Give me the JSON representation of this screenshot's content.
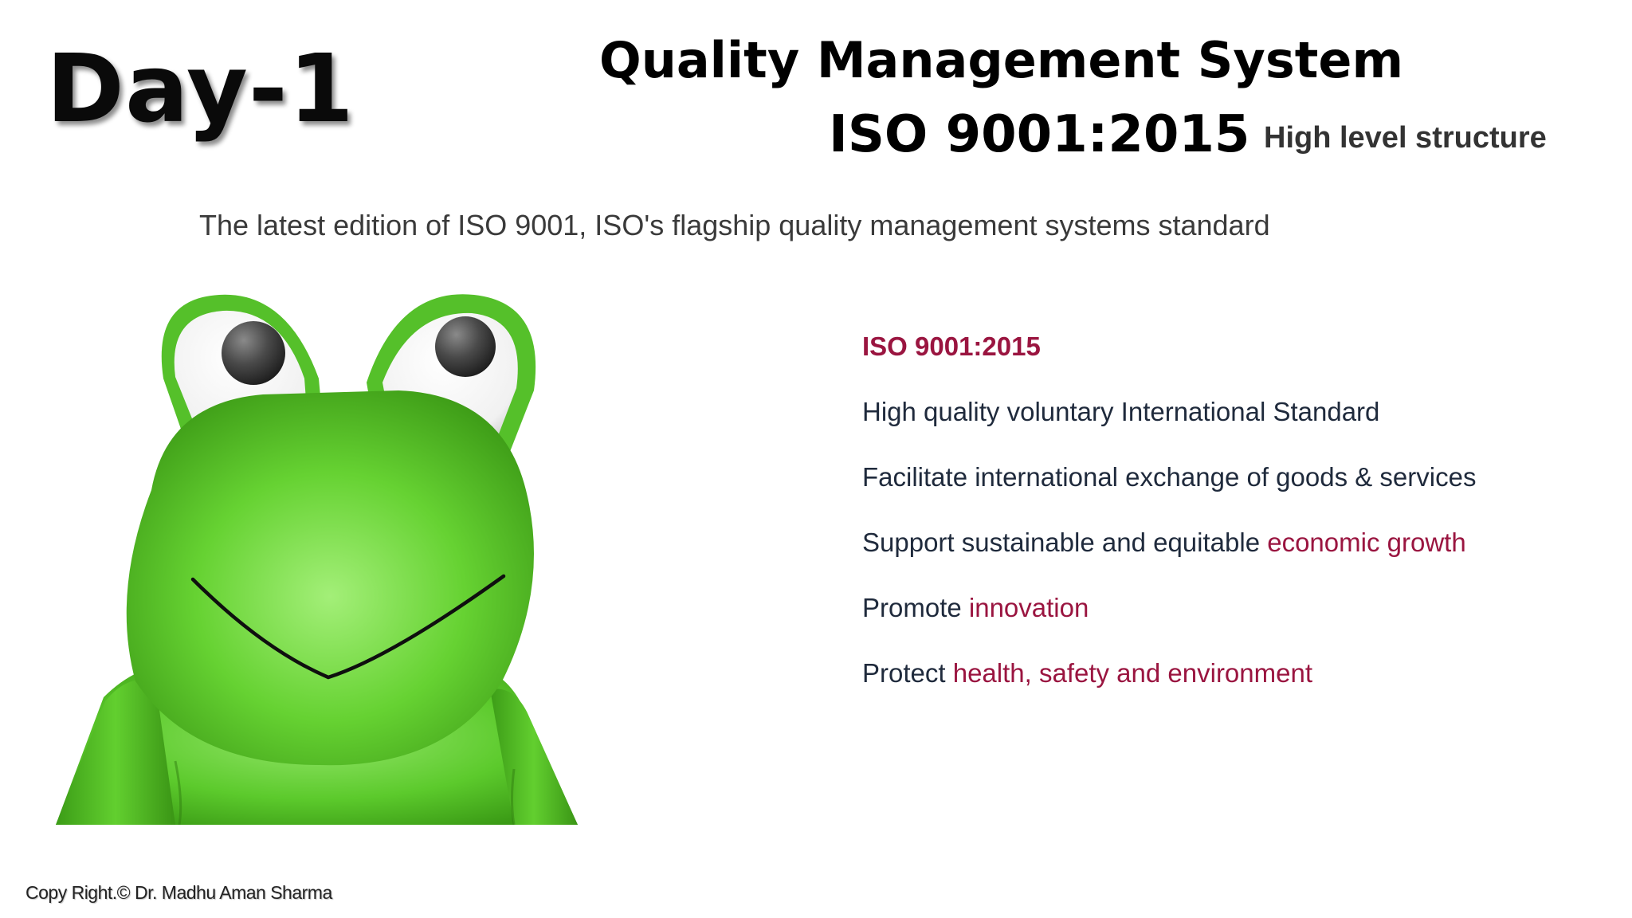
{
  "slide": {
    "day_label": "Day-1",
    "title_line1": "Quality Management System",
    "title_line2": "ISO 9001:2015",
    "subtitle_right": "High level structure",
    "intro": "The latest edition of ISO 9001, ISO's flagship quality management systems standard",
    "mascot_icon": "frog-mascot-icon",
    "bullets": {
      "heading": "ISO 9001:2015",
      "item1": "High quality voluntary International Standard",
      "item2": "Facilitate international exchange of goods & services",
      "item3_prefix": "Support sustainable and equitable ",
      "item3_accent": "economic growth",
      "item4_prefix": "Promote ",
      "item4_accent": "innovation",
      "item5_prefix": "Protect ",
      "item5_accent": "health, safety and environment"
    },
    "copyright": "Copy Right.© Dr. Madhu Aman Sharma"
  },
  "colors": {
    "accent": "#9a1540",
    "body_text": "#1f2a3c",
    "frog_green": "#5ccb2e"
  }
}
